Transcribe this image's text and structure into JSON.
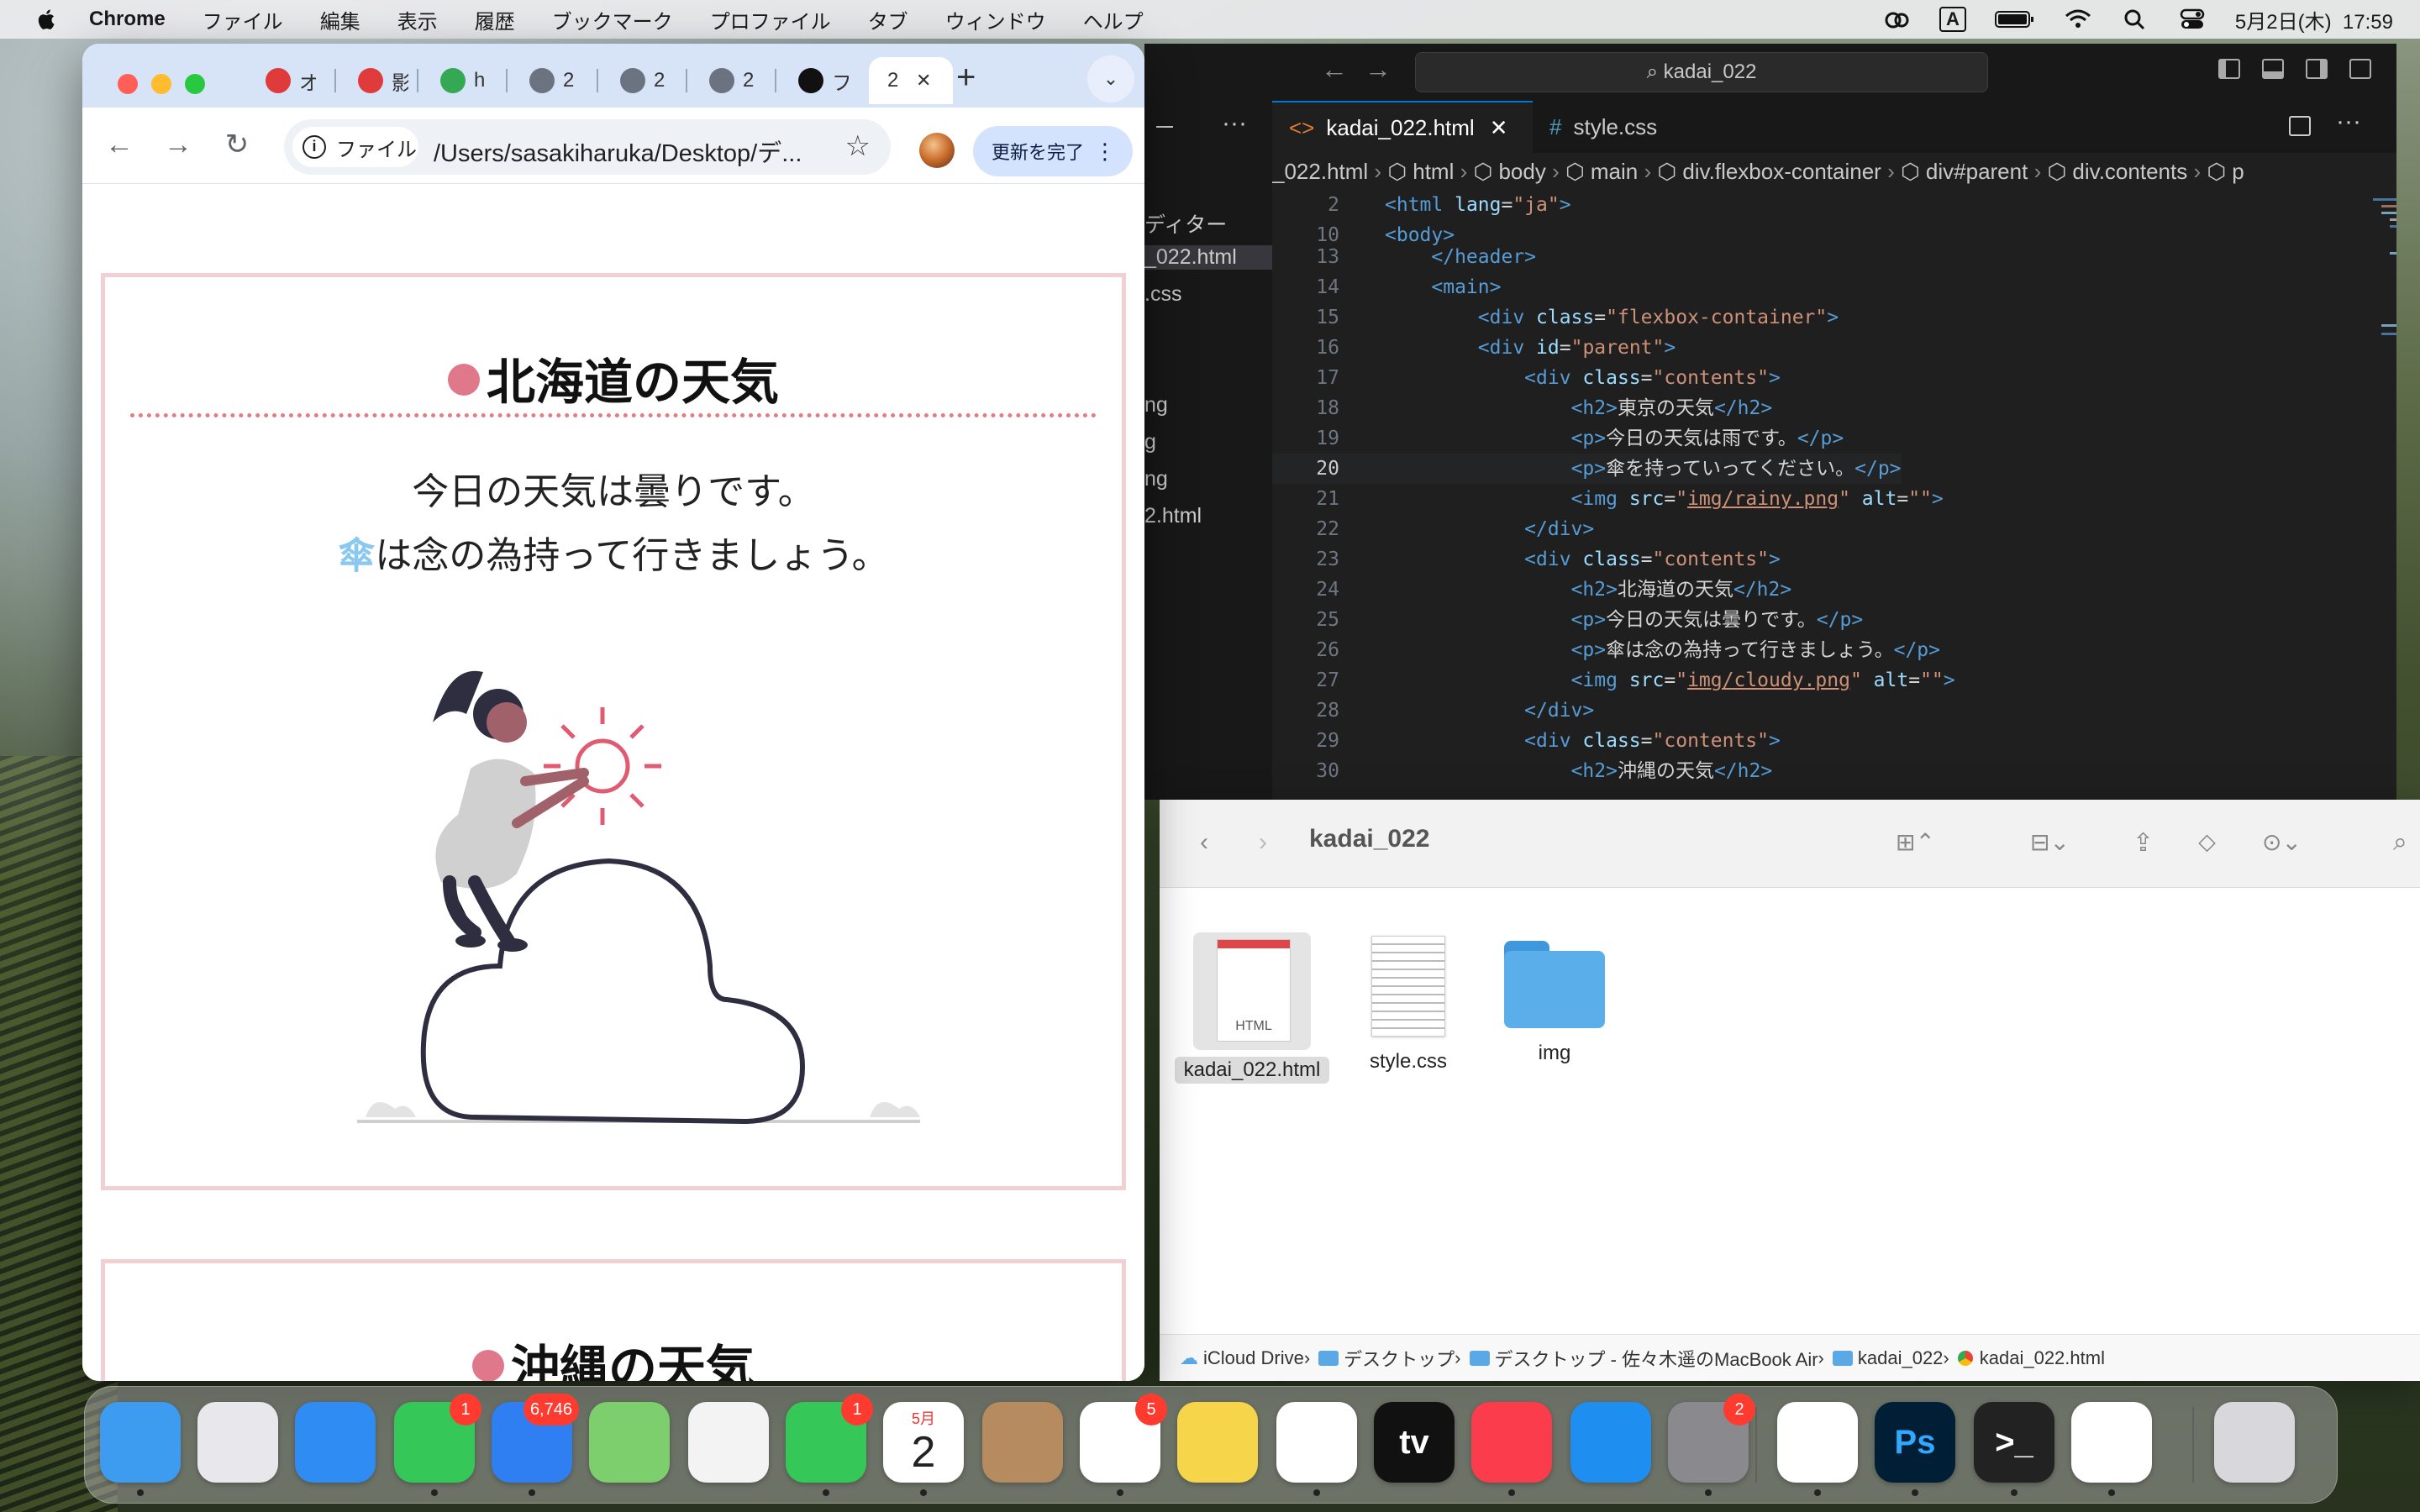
{
  "menubar": {
    "app_name": "Chrome",
    "items": [
      "ファイル",
      "編集",
      "表示",
      "履歴",
      "ブックマーク",
      "プロファイル",
      "タブ",
      "ウィンドウ",
      "ヘルプ"
    ],
    "input_mode": "A",
    "datetime": "5月2日(木)  17:59"
  },
  "chrome": {
    "tabs": [
      {
        "icon": "sumo-icon",
        "label": "オ"
      },
      {
        "icon": "sumo-icon",
        "label": "影"
      },
      {
        "icon": "google-drive-icon",
        "label": "h"
      },
      {
        "icon": "globe-icon",
        "label": "2"
      },
      {
        "icon": "globe-icon",
        "label": "2"
      },
      {
        "icon": "globe-icon",
        "label": "2"
      },
      {
        "icon": "github-icon",
        "label": "フ"
      },
      {
        "icon": "globe-icon",
        "label": "2"
      }
    ],
    "omnibox_chip": "ファイル",
    "url": "/Users/sasakiharuka/Desktop/デ...",
    "update_button": "更新を完了",
    "cards": [
      {
        "title": "北海道の天気",
        "line1": "今日の天気は曇りです。",
        "line2_highlight": "傘",
        "line2_rest": "は念の為持って行きましょう。"
      },
      {
        "title": "沖縄の天気"
      }
    ]
  },
  "vscode": {
    "search_text": "kadai_022",
    "tabs": [
      {
        "label": "kadai_022.html",
        "icon": "html-file-icon",
        "active": true
      },
      {
        "label": "style.css",
        "icon": "css-file-icon",
        "active": false
      }
    ],
    "sidebar_items": [
      "ディター",
      "_022.html",
      ".css",
      "ng",
      "g",
      "ng",
      "2.html"
    ],
    "breadcrumb": [
      "_022.html",
      "html",
      "body",
      "main",
      "div.flexbox-container",
      "div#parent",
      "div.contents",
      "p"
    ],
    "lines": [
      {
        "n": "2",
        "indent": 0,
        "segments": [
          [
            "tag",
            "<html "
          ],
          [
            "attr",
            "lang"
          ],
          [
            "txt",
            "="
          ],
          [
            "str",
            "\"ja\""
          ],
          [
            "tag",
            ">"
          ]
        ]
      },
      {
        "n": "10",
        "indent": 0,
        "segments": [
          [
            "tag",
            "<body>"
          ]
        ]
      },
      {
        "n": "13",
        "indent": 1,
        "segments": [
          [
            "tag",
            "</header>"
          ]
        ]
      },
      {
        "n": "14",
        "indent": 1,
        "segments": [
          [
            "tag",
            "<main>"
          ]
        ]
      },
      {
        "n": "15",
        "indent": 2,
        "segments": [
          [
            "tag",
            "<div "
          ],
          [
            "attr",
            "class"
          ],
          [
            "txt",
            "="
          ],
          [
            "str",
            "\"flexbox-container\""
          ],
          [
            "tag",
            ">"
          ]
        ]
      },
      {
        "n": "16",
        "indent": 2,
        "segments": [
          [
            "tag",
            "<div "
          ],
          [
            "attr",
            "id"
          ],
          [
            "txt",
            "="
          ],
          [
            "str",
            "\"parent\""
          ],
          [
            "tag",
            ">"
          ]
        ]
      },
      {
        "n": "17",
        "indent": 3,
        "segments": [
          [
            "tag",
            "<div "
          ],
          [
            "attr",
            "class"
          ],
          [
            "txt",
            "="
          ],
          [
            "str",
            "\"contents\""
          ],
          [
            "tag",
            ">"
          ]
        ]
      },
      {
        "n": "18",
        "indent": 4,
        "segments": [
          [
            "tag",
            "<h2>"
          ],
          [
            "txt",
            "東京の天気"
          ],
          [
            "tag",
            "</h2>"
          ]
        ]
      },
      {
        "n": "19",
        "indent": 4,
        "segments": [
          [
            "tag",
            "<p>"
          ],
          [
            "txt",
            "今日の天気は雨です。"
          ],
          [
            "tag",
            "</p>"
          ]
        ]
      },
      {
        "n": "20",
        "indent": 4,
        "segments": [
          [
            "tag",
            "<p>"
          ],
          [
            "txt",
            "傘を持っていってください。"
          ],
          [
            "tag",
            "</p>"
          ]
        ],
        "current": true
      },
      {
        "n": "21",
        "indent": 4,
        "segments": [
          [
            "tag",
            "<img "
          ],
          [
            "attr",
            "src"
          ],
          [
            "txt",
            "="
          ],
          [
            "str",
            "\""
          ],
          [
            "strU",
            "img/rainy.png"
          ],
          [
            "str",
            "\" "
          ],
          [
            "attr",
            "alt"
          ],
          [
            "txt",
            "="
          ],
          [
            "str",
            "\"\""
          ],
          [
            "tag",
            ">"
          ]
        ]
      },
      {
        "n": "22",
        "indent": 3,
        "segments": [
          [
            "tag",
            "</div>"
          ]
        ]
      },
      {
        "n": "23",
        "indent": 3,
        "segments": [
          [
            "tag",
            "<div "
          ],
          [
            "attr",
            "class"
          ],
          [
            "txt",
            "="
          ],
          [
            "str",
            "\"contents\""
          ],
          [
            "tag",
            ">"
          ]
        ]
      },
      {
        "n": "24",
        "indent": 4,
        "segments": [
          [
            "tag",
            "<h2>"
          ],
          [
            "txt",
            "北海道の天気"
          ],
          [
            "tag",
            "</h2>"
          ]
        ]
      },
      {
        "n": "25",
        "indent": 4,
        "segments": [
          [
            "tag",
            "<p>"
          ],
          [
            "txt",
            "今日の天気は曇りです。"
          ],
          [
            "tag",
            "</p>"
          ]
        ]
      },
      {
        "n": "26",
        "indent": 4,
        "segments": [
          [
            "tag",
            "<p>"
          ],
          [
            "txt",
            "傘は念の為持って行きましょう。"
          ],
          [
            "tag",
            "</p>"
          ]
        ]
      },
      {
        "n": "27",
        "indent": 4,
        "segments": [
          [
            "tag",
            "<img "
          ],
          [
            "attr",
            "src"
          ],
          [
            "txt",
            "="
          ],
          [
            "str",
            "\""
          ],
          [
            "strU",
            "img/cloudy.png"
          ],
          [
            "str",
            "\" "
          ],
          [
            "attr",
            "alt"
          ],
          [
            "txt",
            "="
          ],
          [
            "str",
            "\"\""
          ],
          [
            "tag",
            ">"
          ]
        ]
      },
      {
        "n": "28",
        "indent": 3,
        "segments": [
          [
            "tag",
            "</div>"
          ]
        ]
      },
      {
        "n": "29",
        "indent": 3,
        "segments": [
          [
            "tag",
            "<div "
          ],
          [
            "attr",
            "class"
          ],
          [
            "txt",
            "="
          ],
          [
            "str",
            "\"contents\""
          ],
          [
            "tag",
            ">"
          ]
        ]
      },
      {
        "n": "30",
        "indent": 4,
        "segments": [
          [
            "tag",
            "<h2>"
          ],
          [
            "txt",
            "沖縄の天気"
          ],
          [
            "tag",
            "</h2>"
          ]
        ]
      }
    ]
  },
  "finder": {
    "title": "kadai_022",
    "files": [
      {
        "name": "kadai_022.html",
        "type_label": "HTML",
        "icon": "html-document-icon",
        "selected": true
      },
      {
        "name": "style.css",
        "icon": "css-document-icon",
        "selected": false
      },
      {
        "name": "img",
        "icon": "folder-icon",
        "selected": false
      }
    ],
    "path": [
      "iCloud Drive",
      "デスクトップ",
      "デスクトップ - 佐々木遥のMacBook Air",
      "kadai_022",
      "kadai_022.html"
    ]
  },
  "dock": {
    "apps": [
      {
        "name": "finder-icon",
        "color": "#3d9bf0"
      },
      {
        "name": "launchpad-icon",
        "color": "#e8e8ec"
      },
      {
        "name": "safari-icon",
        "color": "#2f8cf2"
      },
      {
        "name": "messages-icon",
        "color": "#36c759",
        "badge": "1"
      },
      {
        "name": "mail-icon",
        "color": "#2f7ff2",
        "badge": "6,746"
      },
      {
        "name": "maps-icon",
        "color": "#7ccf6c"
      },
      {
        "name": "photos-icon",
        "color": "#f3f3f3"
      },
      {
        "name": "facetime-icon",
        "color": "#36c759",
        "badge": "1"
      },
      {
        "name": "calendar-icon",
        "color": "#ffffff",
        "month": "5月",
        "day": "2"
      },
      {
        "name": "contacts-icon",
        "color": "#b68b5f"
      },
      {
        "name": "reminders-icon",
        "color": "#ffffff",
        "badge": "5"
      },
      {
        "name": "notes-icon",
        "color": "#f7d54a"
      },
      {
        "name": "freeform-icon",
        "color": "#ffffff"
      },
      {
        "name": "apple-tv-icon",
        "color": "#111111",
        "label": "tv"
      },
      {
        "name": "music-icon",
        "color": "#fa3c4c"
      },
      {
        "name": "app-store-icon",
        "color": "#1f8ef1"
      },
      {
        "name": "system-settings-icon",
        "color": "#8a8a8e",
        "badge": "2"
      },
      {
        "name": "chrome-icon",
        "color": "#ffffff"
      },
      {
        "name": "photoshop-icon",
        "color": "#001e36",
        "label": "Ps"
      },
      {
        "name": "terminal-icon",
        "color": "#222222",
        "label": ">_"
      },
      {
        "name": "vscode-icon",
        "color": "#ffffff"
      },
      {
        "name": "trash-icon",
        "color": "#d8d8dc"
      }
    ]
  }
}
